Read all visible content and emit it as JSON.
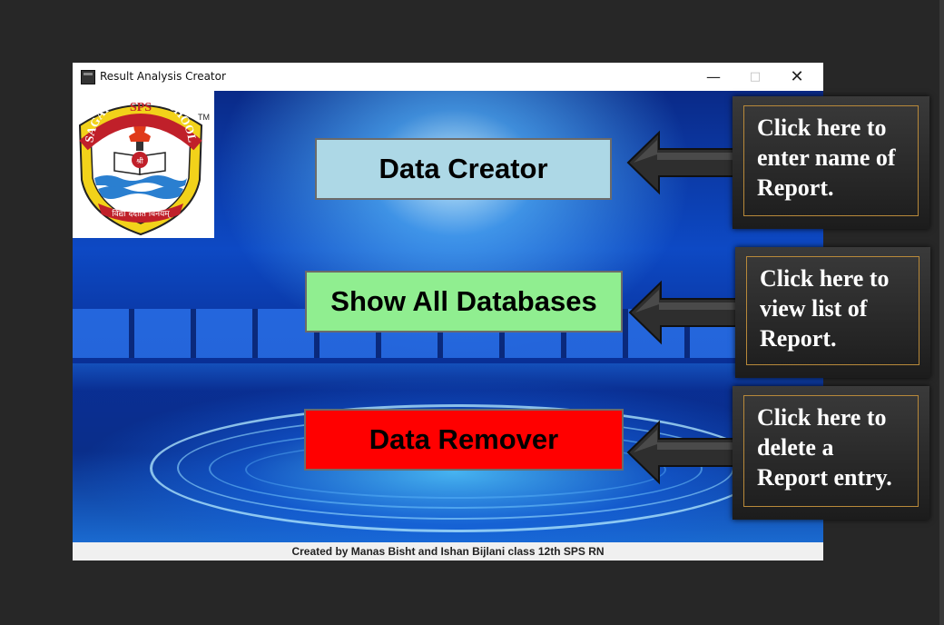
{
  "window": {
    "title": "Result Analysis Creator",
    "controls": {
      "minimize": "—",
      "maximize": "□",
      "close": "✕"
    }
  },
  "logo": {
    "abbr": "SPS",
    "school_name": "SAGAR PUBLIC SCHOOL",
    "motto": "विद्या ददाति विनयम्",
    "book_text": "श्री",
    "tm": "TM"
  },
  "buttons": {
    "data_creator": "Data Creator",
    "show_all": "Show All Databases",
    "data_remover": "Data Remover"
  },
  "status_bar": "Created by Manas Bisht and Ishan Bijlani class 12th SPS RN",
  "callouts": {
    "c1": [
      "Click here to",
      "enter name of",
      "Report."
    ],
    "c2": [
      "Click here to",
      "view list of",
      "Report."
    ],
    "c3": [
      "Click here to",
      "delete a",
      "Report entry."
    ]
  },
  "colors": {
    "data_creator_bg": "#add8e6",
    "show_all_bg": "#90ee90",
    "data_remover_bg": "#ff0000",
    "callout_border": "#b8893a"
  }
}
